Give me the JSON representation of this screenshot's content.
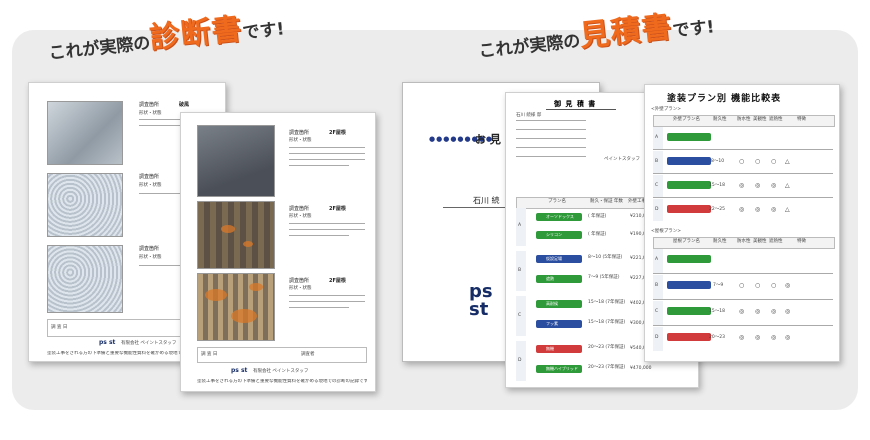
{
  "headings": {
    "left": {
      "prefix": "これが実際の",
      "accent": "診断書",
      "suffix": "です!"
    },
    "right": {
      "prefix": "これが実際の",
      "accent": "見積書",
      "suffix": "です!"
    }
  },
  "diagnosis": {
    "back": {
      "field_label": "調査箇所",
      "rows": [
        {
          "value": "破風",
          "sub": "形状・状態"
        },
        {
          "value": "",
          "sub": "形状・状態"
        },
        {
          "value": "",
          "sub": "形状・状態"
        }
      ],
      "company": "有限会社 ペイントスタッフ",
      "footer": "塗装工事をされる方の下準備と重要な機能性資料を確かめる現地での診断の記録です",
      "sign_label": "調 査 日",
      "sign_label2": "調査者"
    },
    "front": {
      "field_label": "調査箇所",
      "rows": [
        {
          "value": "2F屋根",
          "sub": "形状・状態"
        },
        {
          "value": "2F屋根",
          "sub": "形状・状態"
        },
        {
          "value": "2F屋根",
          "sub": "形状・状態"
        }
      ],
      "company": "有限会社 ペイントスタッフ",
      "footer": "塗装工事をされる方の下準備と重要な機能性資料を確かめる現地での診断の記録です",
      "sign_label": "調 査 日",
      "sign_label2": "調査者"
    }
  },
  "estimate": {
    "cover": {
      "title": "お 見",
      "customer": "石川 続",
      "logo_top": "ps",
      "logo_bottom": "st"
    },
    "quote": {
      "title": "御 見 積 書",
      "customer_line": "石川 続様 邸",
      "company": "ペイントスタッフ",
      "columns": [
        "プラン名",
        "耐久・保証 年数",
        "外壁工事・屋根工事 金額"
      ],
      "plans": [
        {
          "group": "A",
          "rows": [
            {
              "plan": "オーソドックス",
              "years": "( 年保証)",
              "price": "¥210,000"
            },
            {
              "plan": "シリコン",
              "years": "( 年保証)",
              "price": "¥190,000"
            }
          ]
        },
        {
          "group": "B",
          "rows": [
            {
              "plan": "仮設足場",
              "years": "8〜10 (5年保証)",
              "price": "¥221,000"
            },
            {
              "plan": "遮熱",
              "years": "7〜9 (5年保証)",
              "price": "¥227,000"
            }
          ]
        },
        {
          "group": "C",
          "rows": [
            {
              "plan": "高耐候",
              "years": "15〜18 (7年保証)",
              "price": "¥402,000"
            },
            {
              "plan": "フッ素",
              "years": "15〜18 (7年保証)",
              "price": "¥300,000"
            }
          ]
        },
        {
          "group": "D",
          "rows": [
            {
              "plan": "無機",
              "years": "20〜23 (7年保証)",
              "price": "¥540,000"
            },
            {
              "plan": "無機ハイブリッド",
              "years": "20〜23 (7年保証)",
              "price": "¥470,000"
            }
          ]
        }
      ]
    },
    "comparison": {
      "title": "塗装プラン別 機能比較表",
      "section_wall": "<外壁プラン>",
      "section_roof": "<屋根プラン>",
      "columns": [
        "外壁プラン名",
        "耐久性",
        "防水性",
        "美観性",
        "遮熱性",
        "特徴"
      ],
      "roof_columns": [
        "屋根プラン名",
        "耐久性",
        "防水性",
        "美観性",
        "遮熱性",
        "特徴"
      ],
      "wall_rows": [
        {
          "group": "A",
          "durability": "",
          "marks": [
            "",
            "",
            "",
            ""
          ]
        },
        {
          "group": "B",
          "durability": "8〜10",
          "marks": [
            "○",
            "○",
            "○",
            "△"
          ]
        },
        {
          "group": "C",
          "durability": "15〜18",
          "marks": [
            "◎",
            "◎",
            "◎",
            "△"
          ]
        },
        {
          "group": "D",
          "durability": "22〜25",
          "marks": [
            "◎",
            "◎",
            "◎",
            "△"
          ]
        }
      ],
      "roof_rows": [
        {
          "group": "A",
          "durability": "",
          "marks": [
            "",
            "",
            "",
            ""
          ]
        },
        {
          "group": "B",
          "durability": "7〜9",
          "marks": [
            "○",
            "○",
            "○",
            "◎"
          ]
        },
        {
          "group": "C",
          "durability": "15〜18",
          "marks": [
            "◎",
            "◎",
            "◎",
            "◎"
          ]
        },
        {
          "group": "D",
          "durability": "20〜23",
          "marks": [
            "◎",
            "◎",
            "◎",
            "◎"
          ]
        }
      ]
    }
  },
  "colors": {
    "frame": "#ececec",
    "accent": "#f06a1e",
    "brand_blue": "#162c66",
    "ribbon_green": "#2f9a3a",
    "ribbon_blue": "#2b4ea0",
    "ribbon_red": "#d23b3b"
  }
}
